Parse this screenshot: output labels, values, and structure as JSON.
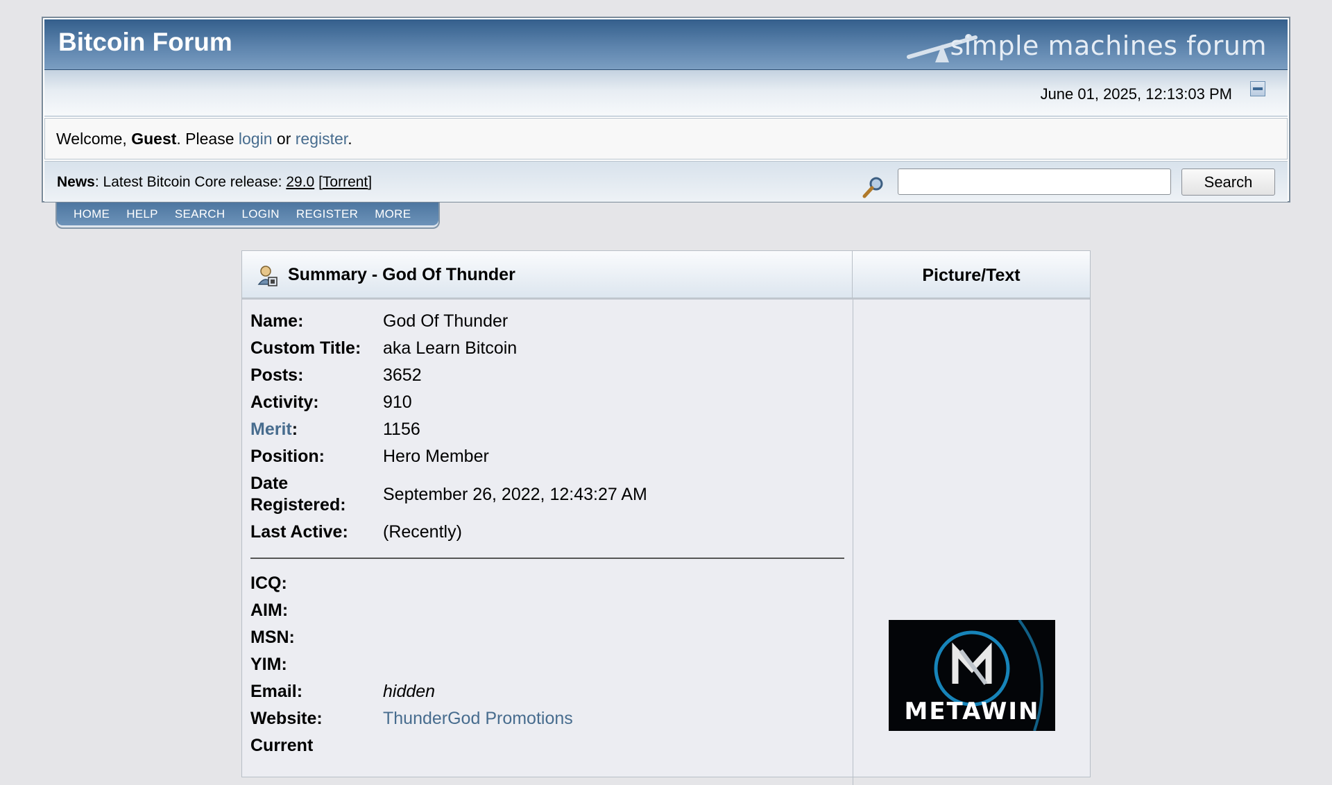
{
  "header": {
    "forum_title": "Bitcoin Forum",
    "logo_text": "simple machines forum",
    "datetime": "June 01, 2025, 12:13:03 PM"
  },
  "welcome": {
    "prefix": "Welcome, ",
    "user": "Guest",
    "middle": ". Please ",
    "login_link": "login",
    "or": " or ",
    "register_link": "register",
    "suffix": "."
  },
  "news": {
    "label": "News",
    "text": ": Latest Bitcoin Core release: ",
    "version_link": "29.0",
    "torrent_link": "Torrent"
  },
  "search": {
    "placeholder": "",
    "button_label": "Search"
  },
  "menu": {
    "items": [
      "HOME",
      "HELP",
      "SEARCH",
      "LOGIN",
      "REGISTER",
      "MORE"
    ]
  },
  "profile": {
    "summary_title": "Summary - God Of Thunder",
    "picture_title": "Picture/Text",
    "fields": [
      {
        "label": "Name:",
        "value": "God Of Thunder"
      },
      {
        "label": "Custom Title:",
        "value": "aka Learn Bitcoin"
      },
      {
        "label": "Posts:",
        "value": "3652"
      },
      {
        "label": "Activity:",
        "value": "910"
      },
      {
        "label": "Merit",
        "value": "1156"
      },
      {
        "label": "Position:",
        "value": "Hero Member"
      },
      {
        "label": "Date Registered:",
        "value": "September 26, 2022, 12:43:27 AM"
      },
      {
        "label": "Last Active:",
        "value": "(Recently)"
      }
    ],
    "contact_fields": [
      {
        "label": "ICQ:",
        "value": ""
      },
      {
        "label": "AIM:",
        "value": ""
      },
      {
        "label": "MSN:",
        "value": ""
      },
      {
        "label": "YIM:",
        "value": ""
      },
      {
        "label": "Email:",
        "value": "hidden"
      },
      {
        "label": "Website:",
        "value": "ThunderGod Promotions"
      },
      {
        "label": "Current",
        "value": ""
      }
    ],
    "avatar_text": "METAWIN"
  },
  "colors": {
    "link": "#476c8e",
    "header_blue": "#345f8c",
    "background": "#e5e5e8"
  }
}
